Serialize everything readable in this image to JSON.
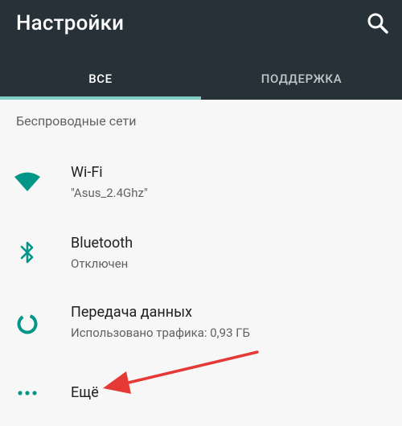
{
  "app_bar": {
    "title": "Настройки",
    "background": "#263238",
    "search_icon": "search-icon"
  },
  "tabs": [
    {
      "label": "ВСЕ",
      "selected": true
    },
    {
      "label": "ПОДДЕРЖКА",
      "selected": false
    }
  ],
  "accent_color": "#009688",
  "indicator_color": "#80cbc4",
  "section": {
    "header": "Беспроводные сети",
    "items": [
      {
        "title": "Wi-Fi",
        "subtitle": "\"Asus_2.4Ghz\"",
        "icon": "wifi-icon"
      },
      {
        "title": "Bluetooth",
        "subtitle": "Отключен",
        "icon": "bluetooth-icon"
      },
      {
        "title": "Передача данных",
        "subtitle": "Использовано трафика: 0,93 ГБ",
        "icon": "data-usage-icon"
      },
      {
        "title": "Ещё",
        "subtitle": "",
        "icon": "more-horiz-icon"
      }
    ]
  },
  "annotation": {
    "arrow_color": "#e53935",
    "points_to": "Ещё"
  }
}
